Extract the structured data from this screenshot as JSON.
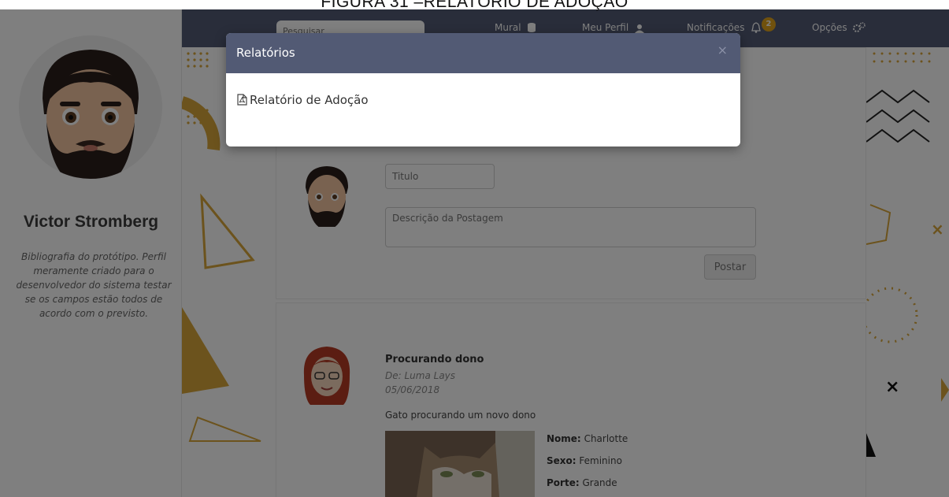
{
  "caption": "FIGURA 31 –RELATÓRIO DE ADOÇÃO",
  "colors": {
    "nav_bg": "#525a74",
    "accent_gold": "#d9a63a",
    "badge": "#e0a21a",
    "overlay": "rgba(0,0,0,0.5)"
  },
  "profile": {
    "name": "Victor Stromberg",
    "bio": "Bibliografia do protótipo. Perfil meramente criado para o desenvolvedor do sistema testar se os campos estão todos de acordo com o previsto.",
    "avatar_icon": "bearded-man-emoji-avatar"
  },
  "nav": {
    "search_placeholder": "Pesquisar",
    "mural": "Mural",
    "mural_icon": "database-icon",
    "perfil": "Meu Perfil",
    "perfil_icon": "user-icon",
    "notificacoes": "Notificações",
    "notificacoes_icon": "bell-icon",
    "notif_count": "2",
    "opcoes": "Opções",
    "opcoes_icon": "gears-icon"
  },
  "post_form": {
    "title_placeholder": "Titulo",
    "description_placeholder": "Descrição da Postagem",
    "submit_label": "Postar"
  },
  "feed": {
    "post_title": "Procurando dono",
    "author": "De: Luma Lays",
    "date": "05/06/2018",
    "text": "Gato procurando um novo dono",
    "pet_name_label": "Nome:",
    "pet_name": "Charlotte",
    "pet_sex_label": "Sexo:",
    "pet_sex": "Feminino",
    "pet_size_label": "Porte:",
    "pet_size": "Grande"
  },
  "modal": {
    "title": "Relatórios",
    "close": "×",
    "link_label": "Relatório de Adoção",
    "link_icon": "pdf-file-icon"
  }
}
